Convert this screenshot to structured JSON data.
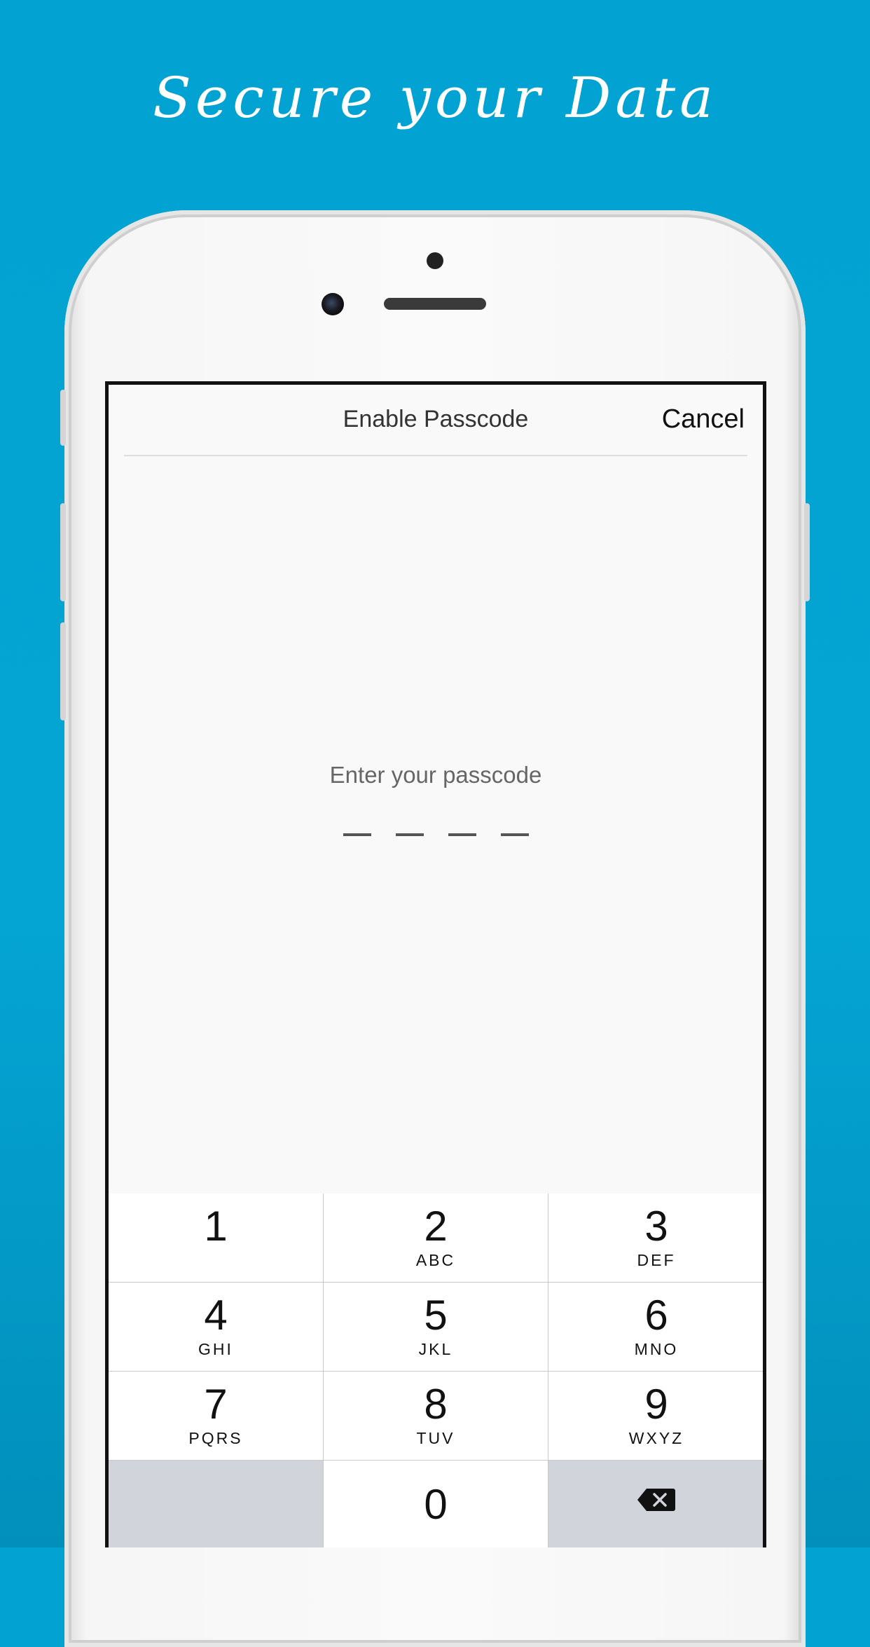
{
  "headline": "Secure your Data",
  "navbar": {
    "title": "Enable Passcode",
    "cancel_label": "Cancel"
  },
  "prompt": "Enter your passcode",
  "passcode_length": 4,
  "keypad": {
    "keys": [
      {
        "digit": "1",
        "letters": ""
      },
      {
        "digit": "2",
        "letters": "ABC"
      },
      {
        "digit": "3",
        "letters": "DEF"
      },
      {
        "digit": "4",
        "letters": "GHI"
      },
      {
        "digit": "5",
        "letters": "JKL"
      },
      {
        "digit": "6",
        "letters": "MNO"
      },
      {
        "digit": "7",
        "letters": "PQRS"
      },
      {
        "digit": "8",
        "letters": "TUV"
      },
      {
        "digit": "9",
        "letters": "WXYZ"
      },
      {
        "digit": "0",
        "letters": ""
      }
    ],
    "delete_icon": "backspace-icon"
  },
  "colors": {
    "background": "#04a4d3",
    "screen": "#f9f9f9",
    "keypad_dark": "#d1d4db"
  }
}
